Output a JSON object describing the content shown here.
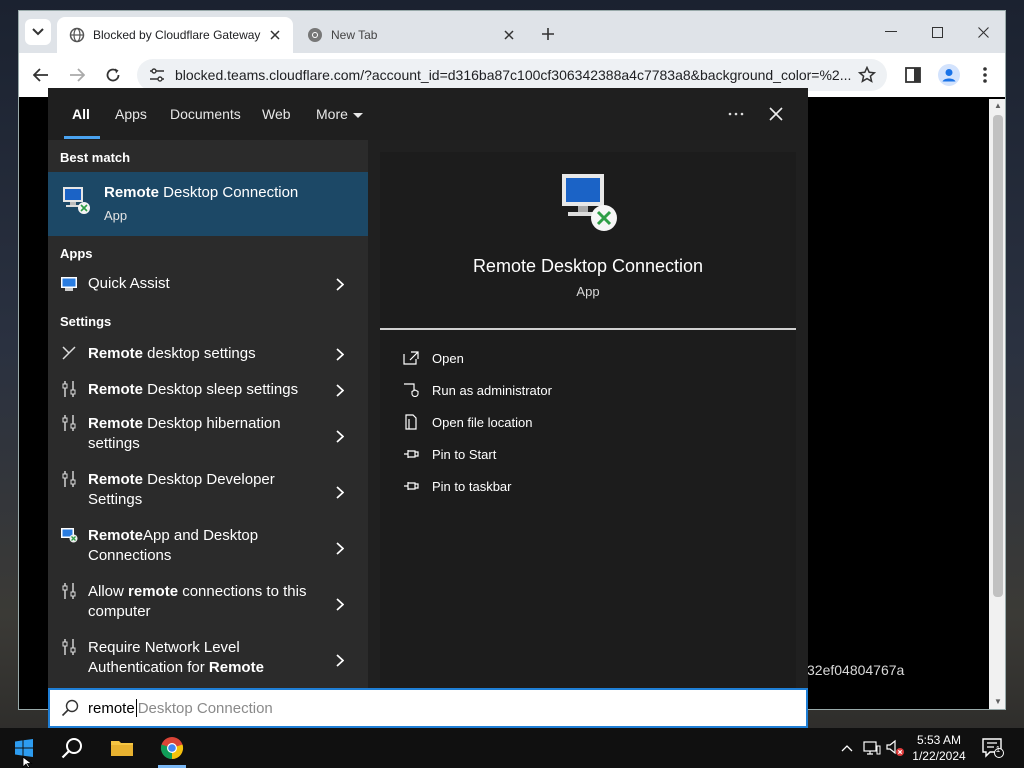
{
  "browser": {
    "tabs": [
      {
        "title": "Blocked by Cloudflare Gateway",
        "active": true
      },
      {
        "title": "New Tab",
        "active": false
      }
    ],
    "url": "blocked.teams.cloudflare.com/?account_id=d316ba87c100cf306342388a4c7783a8&background_color=%2...",
    "page_text": "32ef04804767a"
  },
  "search": {
    "filters": [
      "All",
      "Apps",
      "Documents",
      "Web",
      "More"
    ],
    "best_match_label": "Best match",
    "best_match": {
      "name_bold": "Remote",
      "name_rest": " Desktop Connection",
      "type": "App"
    },
    "apps_label": "Apps",
    "apps": [
      {
        "label": "Quick Assist"
      }
    ],
    "settings_label": "Settings",
    "settings": [
      {
        "bold": "Remote",
        "rest": " desktop settings"
      },
      {
        "bold": "Remote",
        "rest": " Desktop sleep settings"
      },
      {
        "bold": "Remote",
        "rest": " Desktop hibernation settings"
      },
      {
        "bold": "Remote",
        "rest": " Desktop Developer Settings"
      },
      {
        "bold": "Remote",
        "rest": "App and Desktop Connections"
      },
      {
        "pre": "Allow ",
        "bold": "remote",
        "rest": " connections to this computer"
      },
      {
        "pre": "Require Network Level Authentication for ",
        "bold": "Remote",
        "rest": ""
      }
    ],
    "detail": {
      "name": "Remote Desktop Connection",
      "type": "App",
      "actions": [
        "Open",
        "Run as administrator",
        "Open file location",
        "Pin to Start",
        "Pin to taskbar"
      ]
    },
    "query_typed": "remote",
    "query_suggestion": " Desktop Connection"
  },
  "taskbar": {
    "time": "5:53 AM",
    "date": "1/22/2024",
    "notification_count": "1"
  },
  "colors": {
    "accent": "#1c4866",
    "search_border": "#1f7fd6",
    "panel_bg": "#202020"
  }
}
